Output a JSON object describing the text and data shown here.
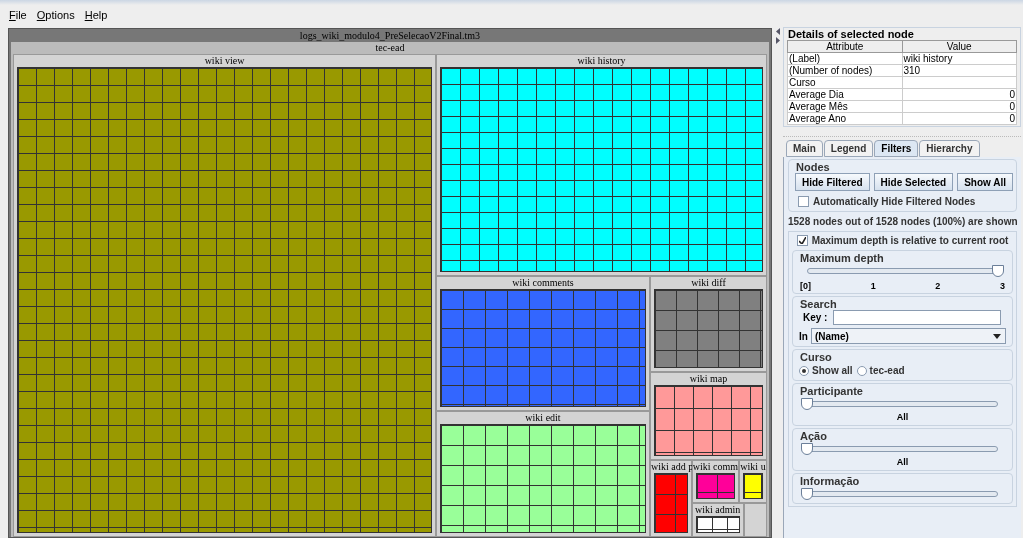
{
  "menu": [
    {
      "label": "File"
    },
    {
      "label": "Options"
    },
    {
      "label": "Help"
    }
  ],
  "treemap": {
    "title": "logs_wiki_modulo4_PreSelecaoV2Final.tm3",
    "root": {
      "label": "tec-ead",
      "children": [
        {
          "label": "wiki view",
          "color": "#999900"
        },
        {
          "label": "wiki history",
          "color": "#00ffff"
        },
        {
          "label": "wiki comments",
          "color": "#3366ff"
        },
        {
          "label": "wiki edit",
          "color": "#99ff99"
        },
        {
          "label": "wiki diff",
          "color": "#808080"
        },
        {
          "label": "wiki map",
          "color": "#ff9999"
        },
        {
          "label": "wiki add p",
          "color": "#ff0000"
        },
        {
          "label": "wiki comm",
          "color": "#ff0099"
        },
        {
          "label": "wiki u",
          "color": "#ffff00"
        },
        {
          "label": "wiki admin",
          "color": "#ffffff"
        }
      ]
    }
  },
  "details": {
    "title": "Details of selected node",
    "columns": [
      "Attribute",
      "Value"
    ],
    "rows": [
      {
        "attribute": "(Label)",
        "value": "wiki history"
      },
      {
        "attribute": "(Number of nodes)",
        "value": "310"
      },
      {
        "attribute": "Curso",
        "value": ""
      },
      {
        "attribute": "Average Dia",
        "value": "0"
      },
      {
        "attribute": "Average Mês",
        "value": "0"
      },
      {
        "attribute": "Average Ano",
        "value": "0"
      }
    ]
  },
  "tabs": [
    {
      "label": "Main",
      "selected": false
    },
    {
      "label": "Legend",
      "selected": false
    },
    {
      "label": "Filters",
      "selected": true
    },
    {
      "label": "Hierarchy",
      "selected": false
    }
  ],
  "filters": {
    "nodes_title": "Nodes",
    "buttons": [
      "Hide Filtered",
      "Hide Selected",
      "Show All"
    ],
    "auto_hide": {
      "label": "Automatically Hide Filtered Nodes",
      "checked": false
    },
    "status": "**1528** nodes out of **1528** nodes (100%) are shown",
    "relative": {
      "label": "Maximum depth is relative to current root",
      "checked": true
    },
    "depth": {
      "title": "Maximum depth",
      "level": 1,
      "ticks": [
        "[0]",
        "1",
        "2",
        "3"
      ]
    },
    "search": {
      "title": "Search",
      "key_label": "Key :",
      "in_label": "In",
      "in_value": "(Name)"
    },
    "curso": {
      "title": "Curso",
      "options": [
        {
          "label": "Show all",
          "selected": true
        },
        {
          "label": "tec-ead",
          "selected": false
        }
      ]
    },
    "sliders": [
      {
        "title": "Participante",
        "level": 0,
        "value": "All"
      },
      {
        "title": "Ação",
        "level": 0,
        "value": "All"
      },
      {
        "title": "Informação",
        "level": 0
      }
    ]
  }
}
